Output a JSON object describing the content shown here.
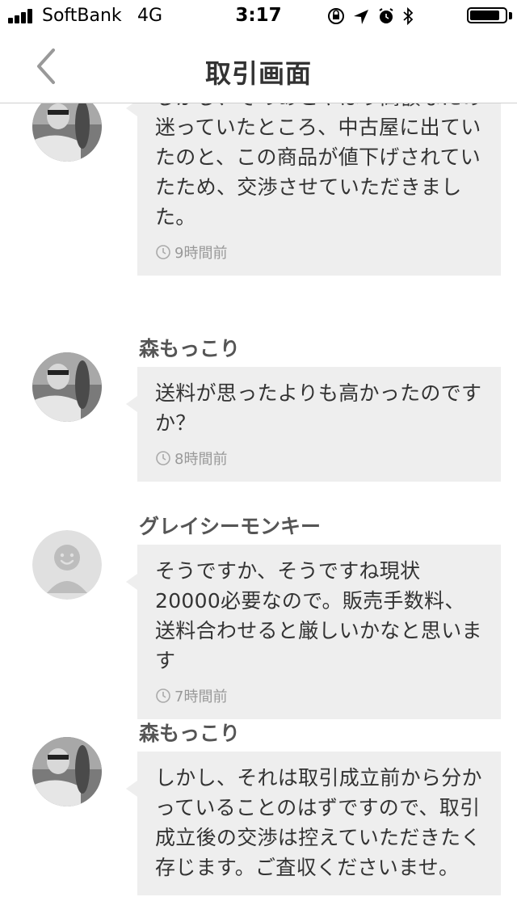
{
  "status_bar": {
    "carrier": "SoftBank",
    "network": "4G",
    "time": "3:17",
    "signal_bars": 4,
    "battery_level": 0.85
  },
  "header": {
    "title": "取引画面",
    "back_icon": "chevron-left-icon"
  },
  "messages": [
    {
      "sender": "",
      "avatar": "user-photo-avatar",
      "text": "しかし、そのあとやはり高額なため迷っていたところ、中古屋に出ていたのと、この商品が値下げされていたため、交渉させていただきました。",
      "time": "9時間前"
    },
    {
      "sender": "森もっこり",
      "avatar": "user-photo-avatar",
      "text": "送料が思ったよりも高かったのですか？",
      "time": "8時間前"
    },
    {
      "sender": "グレイシーモンキー",
      "avatar": "default-avatar",
      "text": "そうですか、そうですね現状20000必要なので。販売手数料、送料合わせると厳しいかなと思います",
      "time": "7時間前"
    },
    {
      "sender": "森もっこり",
      "avatar": "user-photo-avatar",
      "text": "しかし、それは取引成立前から分かっていることのはずですので、取引成立後の交渉は控えていただきたく存じます。ご査収くださいませ。",
      "time": ""
    }
  ],
  "colors": {
    "bubble_bg": "#eeeeee",
    "text": "#333333",
    "timestamp": "#999999"
  }
}
